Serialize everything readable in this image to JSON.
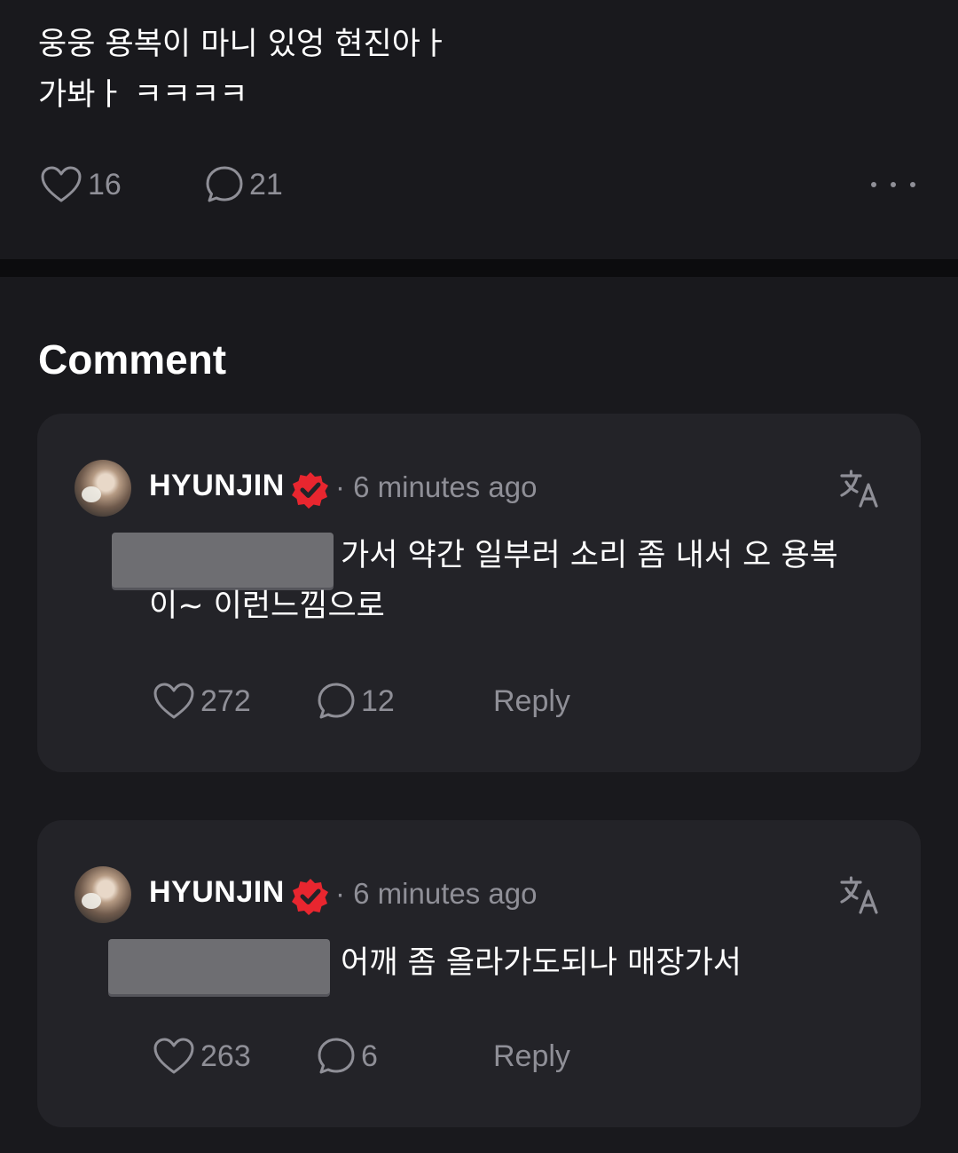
{
  "post": {
    "text_line1": "웅웅 용복이 마니 있엉 현진아ㅏ",
    "text_line2": "가봐ㅏ ㅋㅋㅋㅋ",
    "likes": "16",
    "comments": "21"
  },
  "section_title": "Comment",
  "comments": [
    {
      "username": "HYUNJIN",
      "time": "· 6 minutes ago",
      "text_line1": "가서 약간 일부러 소리 좀 내서 오 용복",
      "text_line2": "이~ 이런느낌으로",
      "likes": "272",
      "replies": "12",
      "reply_label": "Reply"
    },
    {
      "username": "HYUNJIN",
      "time": "· 6 minutes ago",
      "text_line1": "어깨 좀 올라가도되나 매장가서",
      "likes": "263",
      "replies": "6",
      "reply_label": "Reply"
    }
  ],
  "colors": {
    "background": "#19191d",
    "card": "#232328",
    "muted": "#8f8f97",
    "verified_badge": "#e8262f"
  },
  "icons": [
    "heart-icon",
    "comment-bubble-icon",
    "more-dots-icon",
    "verified-badge-icon",
    "translate-icon"
  ]
}
